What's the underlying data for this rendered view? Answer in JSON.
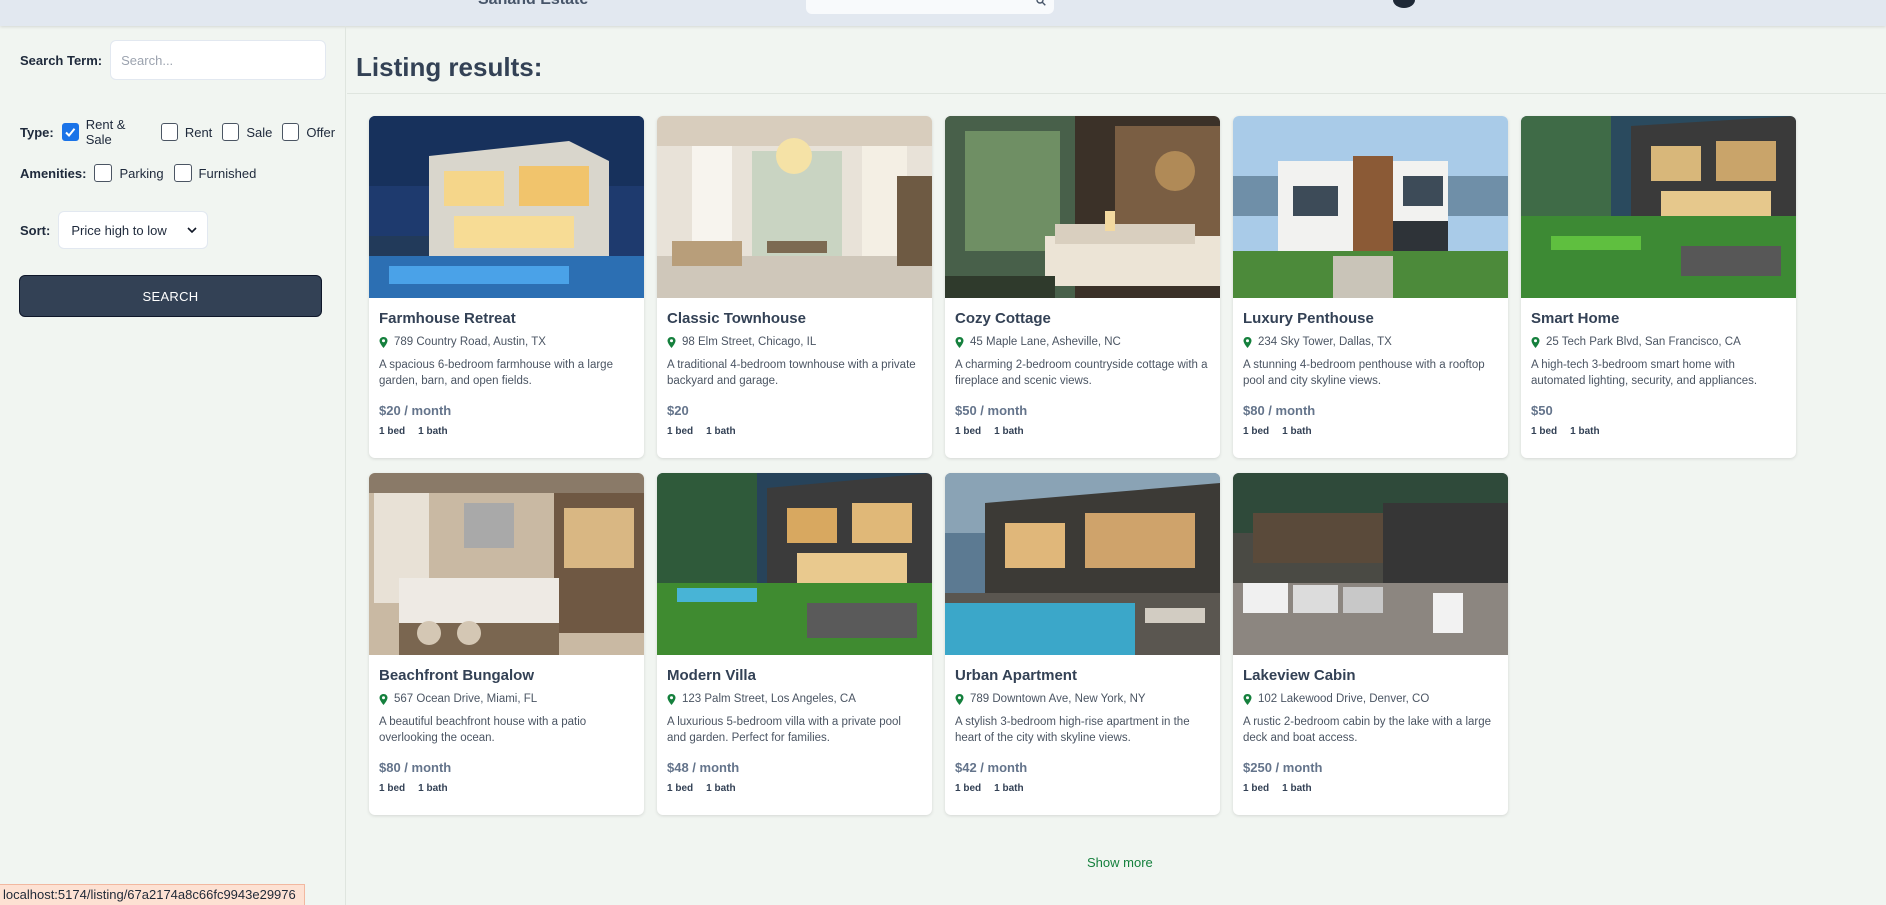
{
  "header": {
    "brand": "Sahand Estate",
    "search_placeholder": ""
  },
  "sidebar": {
    "search_label": "Search Term:",
    "search_placeholder": "Search...",
    "type_label": "Type:",
    "type_options": [
      {
        "label": "Rent & Sale",
        "checked": true
      },
      {
        "label": "Rent",
        "checked": false
      },
      {
        "label": "Sale",
        "checked": false
      },
      {
        "label": "Offer",
        "checked": false
      }
    ],
    "amenities_label": "Amenities:",
    "amenities_options": [
      {
        "label": "Parking",
        "checked": false
      },
      {
        "label": "Furnished",
        "checked": false
      }
    ],
    "sort_label": "Sort:",
    "sort_value": "Price high to low",
    "search_button": "SEARCH"
  },
  "main": {
    "heading": "Listing results:",
    "show_more": "Show more"
  },
  "listings": [
    {
      "title": "Farmhouse Retreat",
      "address": "789 Country Road, Austin, TX",
      "description": "A spacious 6-bedroom farmhouse with a large garden, barn, and open fields.",
      "price": "$20 / month",
      "beds": "1 bed",
      "baths": "1 bath",
      "image": "modern-villa-night-pool"
    },
    {
      "title": "Classic Townhouse",
      "address": "98 Elm Street, Chicago, IL",
      "description": "A traditional 4-bedroom townhouse with a private backyard and garage.",
      "price": "$20",
      "beds": "1 bed",
      "baths": "1 bath",
      "image": "luxury-living-room-chandelier"
    },
    {
      "title": "Cozy Cottage",
      "address": "45 Maple Lane, Asheville, NC",
      "description": "A charming 2-bedroom countryside cottage with a fireplace and scenic views.",
      "price": "$50 / month",
      "beds": "1 bed",
      "baths": "1 bath",
      "image": "luxury-bedroom"
    },
    {
      "title": "Luxury Penthouse",
      "address": "234 Sky Tower, Dallas, TX",
      "description": "A stunning 4-bedroom penthouse with a rooftop pool and city skyline views.",
      "price": "$80 / month",
      "beds": "1 bed",
      "baths": "1 bath",
      "image": "modern-house-day"
    },
    {
      "title": "Smart Home",
      "address": "25 Tech Park Blvd, San Francisco, CA",
      "description": "A high-tech 3-bedroom smart home with automated lighting, security, and appliances.",
      "price": "$50",
      "beds": "1 bed",
      "baths": "1 bath",
      "image": "garden-villas"
    },
    {
      "title": "Beachfront Bungalow",
      "address": "567 Ocean Drive, Miami, FL",
      "description": "A beautiful beachfront house with a patio overlooking the ocean.",
      "price": "$80 / month",
      "beds": "1 bed",
      "baths": "1 bath",
      "image": "modern-kitchen"
    },
    {
      "title": "Modern Villa",
      "address": "123 Palm Street, Los Angeles, CA",
      "description": "A luxurious 5-bedroom villa with a private pool and garden. Perfect for families.",
      "price": "$48 / month",
      "beds": "1 bed",
      "baths": "1 bath",
      "image": "garden-villas-dusk"
    },
    {
      "title": "Urban Apartment",
      "address": "789 Downtown Ave, New York, NY",
      "description": "A stylish 3-bedroom high-rise apartment in the heart of the city with skyline views.",
      "price": "$42 / month",
      "beds": "1 bed",
      "baths": "1 bath",
      "image": "villa-pool-dusk"
    },
    {
      "title": "Lakeview Cabin",
      "address": "102 Lakewood Drive, Denver, CO",
      "description": "A rustic 2-bedroom cabin by the lake with a large deck and boat access.",
      "price": "$250 / month",
      "beds": "1 bed",
      "baths": "1 bath",
      "image": "driveway-cars"
    }
  ],
  "status_bar": {
    "url": "localhost:5174/listing/67a2174a8c66fc9943e29976"
  },
  "colors": {
    "accent": "#334155",
    "checkbox": "#1a73e8",
    "pin": "#15803d",
    "show_more": "#15803d",
    "status_bg": "#fde1d3"
  }
}
